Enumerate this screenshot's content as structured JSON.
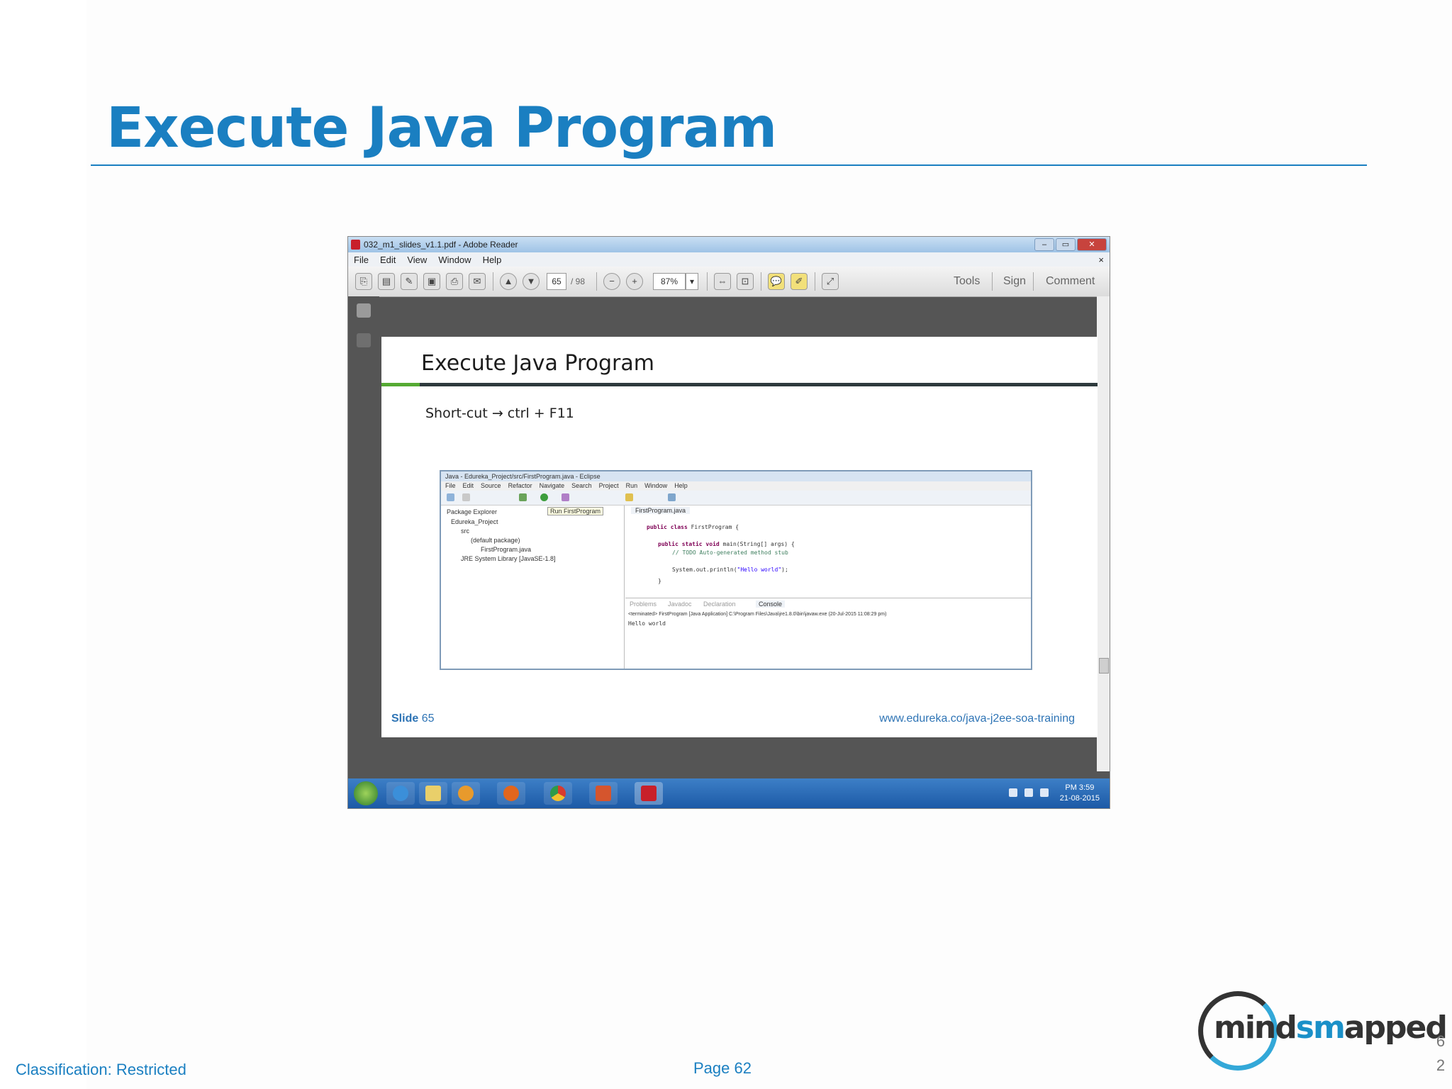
{
  "slide": {
    "title": "Execute Java Program",
    "footer_classification": "Classification: Restricted",
    "footer_page": "Page 62",
    "slide_number_top": "6",
    "slide_number_bottom": "2",
    "logo": {
      "prefix": "mind",
      "brand_blue": "sm",
      "suffix": "apped",
      "full": "mindsmapped"
    }
  },
  "reader": {
    "window_title": "032_m1_slides_v1.1.pdf - Adobe Reader",
    "menu": [
      "File",
      "Edit",
      "View",
      "Window",
      "Help"
    ],
    "close_glyph": "×",
    "page_current": "65",
    "page_total": "/ 98",
    "zoom": "87%",
    "right_tools": [
      "Tools",
      "Sign",
      "Comment"
    ]
  },
  "embedded_slide": {
    "title": "Execute Java Program",
    "shortcut": "Short-cut → ctrl + F11",
    "slide_label": "Slide",
    "slide_number": "65",
    "url": "www.edureka.co/java-j2ee-soa-training"
  },
  "eclipse": {
    "window_title": "Java - Edureka_Project/src/FirstProgram.java - Eclipse",
    "menu": [
      "File",
      "Edit",
      "Source",
      "Refactor",
      "Navigate",
      "Search",
      "Project",
      "Run",
      "Window",
      "Help"
    ],
    "package_explorer": "Package Explorer",
    "tooltip": "Run FirstProgram",
    "tree": [
      "Edureka_Project",
      "src",
      "(default package)",
      "FirstProgram.java",
      "JRE System Library [JavaSE-1.8]"
    ],
    "editor_tab": "FirstProgram.java",
    "code": {
      "line1_kw": "public class",
      "line1_rest": " FirstProgram {",
      "line2_kw": "public static void",
      "line2_rest": " main(String[] args) {",
      "line3": "// TODO Auto-generated method stub",
      "line4_a": "System.out.println(",
      "line4_str": "\"Hello world\"",
      "line4_b": ");",
      "line5": "}"
    },
    "console_tabs": [
      "Problems",
      "Javadoc",
      "Declaration",
      "Console"
    ],
    "console_header": "<terminated> FirstProgram [Java Application] C:\\Program Files\\Java\\jre1.8.0\\bin\\javaw.exe (20-Jul-2015 11:08:29 pm)",
    "console_output": "Hello world"
  },
  "taskbar": {
    "time": "PM 3:59",
    "date": "21-08-2015"
  },
  "colors": {
    "accent_blue": "#1a7fc1",
    "embedded_blue": "#2e74b5",
    "green_bar": "#55aa33"
  }
}
